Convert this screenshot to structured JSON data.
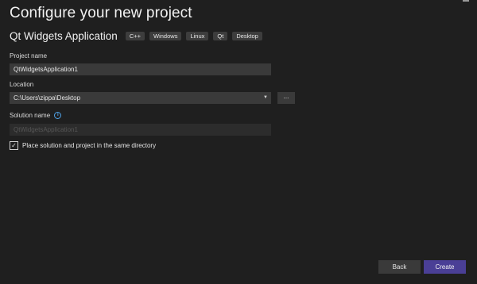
{
  "title": "Configure your new project",
  "template": {
    "name": "Qt Widgets Application",
    "tags": [
      "C++",
      "Windows",
      "Linux",
      "Qt",
      "Desktop"
    ]
  },
  "project_name": {
    "label": "Project name",
    "value": "QtWidgetsApplication1"
  },
  "location": {
    "label": "Location",
    "value": "C:\\Users\\zippa\\Desktop",
    "browse_label": "...",
    "dropdown_glyph": "▼"
  },
  "solution_name": {
    "label": "Solution name",
    "placeholder": "QtWidgetsApplication1",
    "info_glyph": "i"
  },
  "same_directory": {
    "label": "Place solution and project in the same directory",
    "checked": true,
    "check_glyph": "✓"
  },
  "buttons": {
    "back": "Back",
    "create": "Create"
  },
  "colors": {
    "background": "#1f1f1f",
    "accent": "#4a3f96",
    "info": "#4fa3e8"
  }
}
